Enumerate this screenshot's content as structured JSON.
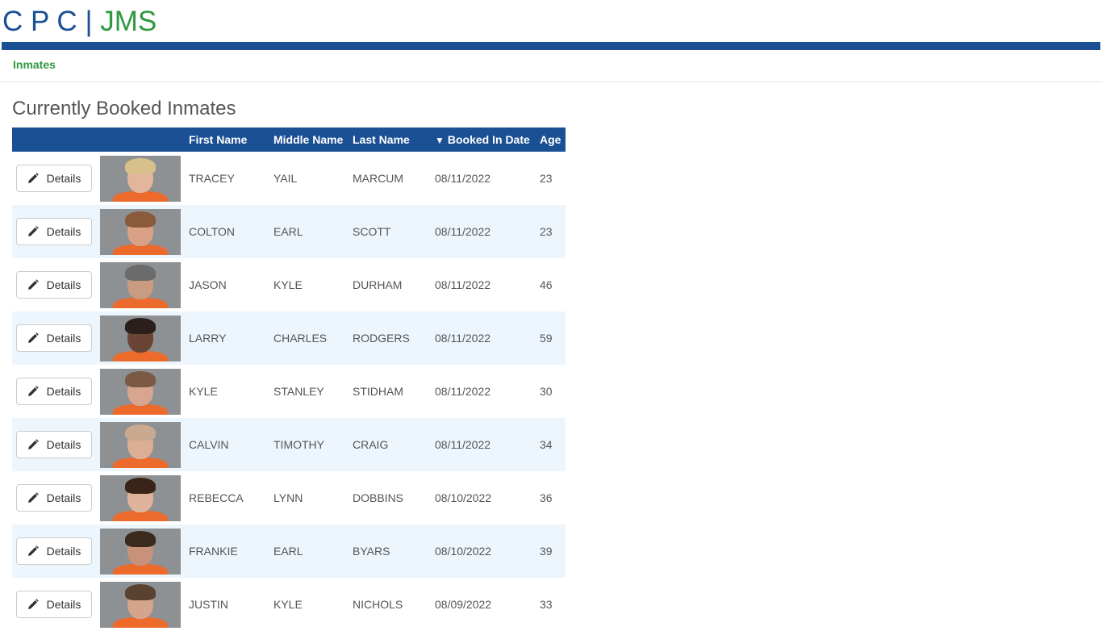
{
  "brand": {
    "part1": "C P C",
    "separator": "|",
    "part2": "JMS"
  },
  "nav": {
    "inmates": "Inmates"
  },
  "page": {
    "title": "Currently Booked Inmates"
  },
  "table": {
    "headers": {
      "first_name": "First Name",
      "middle_name": "Middle Name",
      "last_name": "Last Name",
      "booked_in_date": "Booked In Date",
      "booked_sort_indicator": "▼",
      "age": "Age"
    },
    "details_label": "Details",
    "rows": [
      {
        "first": "TRACEY",
        "middle": "YAIL",
        "last": "MARCUM",
        "date": "08/11/2022",
        "age": "23"
      },
      {
        "first": "COLTON",
        "middle": "EARL",
        "last": "SCOTT",
        "date": "08/11/2022",
        "age": "23"
      },
      {
        "first": "JASON",
        "middle": "KYLE",
        "last": "DURHAM",
        "date": "08/11/2022",
        "age": "46"
      },
      {
        "first": "LARRY",
        "middle": "CHARLES",
        "last": "RODGERS",
        "date": "08/11/2022",
        "age": "59"
      },
      {
        "first": "KYLE",
        "middle": "STANLEY",
        "last": "STIDHAM",
        "date": "08/11/2022",
        "age": "30"
      },
      {
        "first": "CALVIN",
        "middle": "TIMOTHY",
        "last": "CRAIG",
        "date": "08/11/2022",
        "age": "34"
      },
      {
        "first": "REBECCA",
        "middle": "LYNN",
        "last": "DOBBINS",
        "date": "08/10/2022",
        "age": "36"
      },
      {
        "first": "FRANKIE",
        "middle": "EARL",
        "last": "BYARS",
        "date": "08/10/2022",
        "age": "39"
      },
      {
        "first": "JUSTIN",
        "middle": "KYLE",
        "last": "NICHOLS",
        "date": "08/09/2022",
        "age": "33"
      }
    ]
  },
  "colors": {
    "brand_blue": "#1b5095",
    "brand_green": "#2f9a42",
    "row_alt": "#eef6fd",
    "shirt_orange": "#ec6a2c"
  },
  "icons": {
    "details_button": "pencil-icon"
  }
}
